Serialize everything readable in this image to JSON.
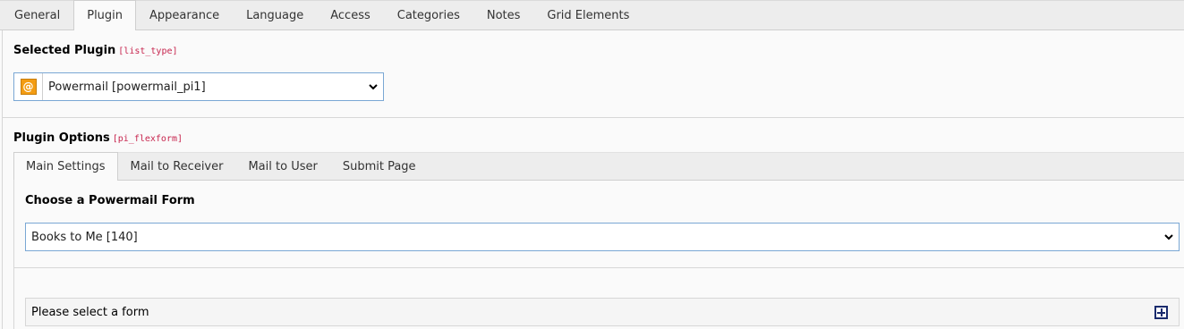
{
  "tabs": [
    {
      "label": "General",
      "active": false
    },
    {
      "label": "Plugin",
      "active": true
    },
    {
      "label": "Appearance",
      "active": false
    },
    {
      "label": "Language",
      "active": false
    },
    {
      "label": "Access",
      "active": false
    },
    {
      "label": "Categories",
      "active": false
    },
    {
      "label": "Notes",
      "active": false
    },
    {
      "label": "Grid Elements",
      "active": false
    }
  ],
  "selected_plugin": {
    "label": "Selected Plugin",
    "field_name": "[list_type]",
    "icon": "at-sign-icon",
    "value": "Powermail [powermail_pi1]"
  },
  "plugin_options": {
    "label": "Plugin Options",
    "field_name": "[pi_flexform]"
  },
  "subtabs": [
    {
      "label": "Main Settings",
      "active": true
    },
    {
      "label": "Mail to Receiver",
      "active": false
    },
    {
      "label": "Mail to User",
      "active": false
    },
    {
      "label": "Submit Page",
      "active": false
    }
  ],
  "form_chooser": {
    "label": "Choose a Powermail Form",
    "value": "Books to Me [140]"
  },
  "form_panel": {
    "text": "Please select a form",
    "icon": "expand-plus-icon"
  },
  "colors": {
    "accent_border": "#7aa7d4",
    "field_name": "#c7254e",
    "plugin_icon": "#f39c12",
    "plus_icon": "#1a2b6d"
  }
}
